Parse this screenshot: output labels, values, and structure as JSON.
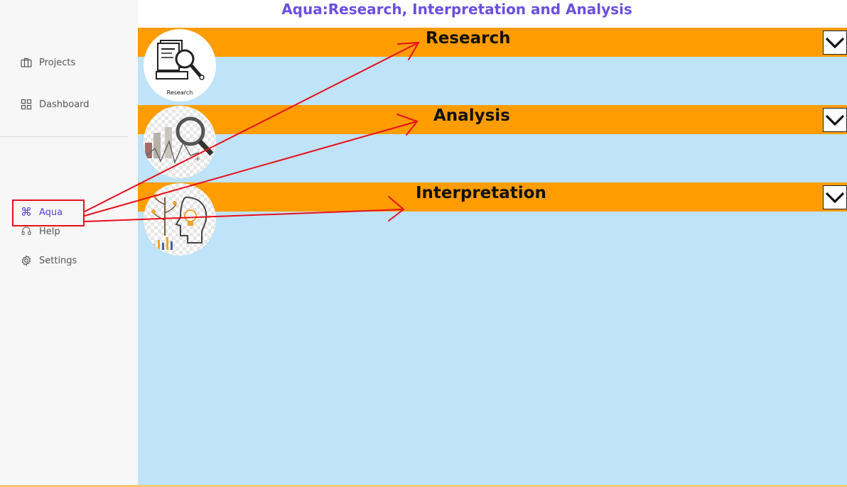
{
  "sidebar": {
    "items": [
      {
        "label": "Projects",
        "icon": "briefcase-icon"
      },
      {
        "label": "Dashboard",
        "icon": "grid-icon"
      },
      {
        "label": "Aqua",
        "icon": "command-icon",
        "active": true
      },
      {
        "label": "Help",
        "icon": "headset-icon"
      },
      {
        "label": "Settings",
        "icon": "gear-icon"
      }
    ]
  },
  "header": {
    "title": "Aqua:Research, Interpretation and Analysis"
  },
  "sections": [
    {
      "label": "Research",
      "image_caption": "Research",
      "icon": "research-magnifier-icon"
    },
    {
      "label": "Analysis",
      "icon": "analysis-chart-magnifier-icon"
    },
    {
      "label": "Interpretation",
      "icon": "interpretation-head-lightbulb-icon"
    }
  ],
  "colors": {
    "accent": "#6a4fe0",
    "bar": "#ff9d00",
    "content_bg": "#bfe3f8",
    "annotation": "#e8101a"
  }
}
